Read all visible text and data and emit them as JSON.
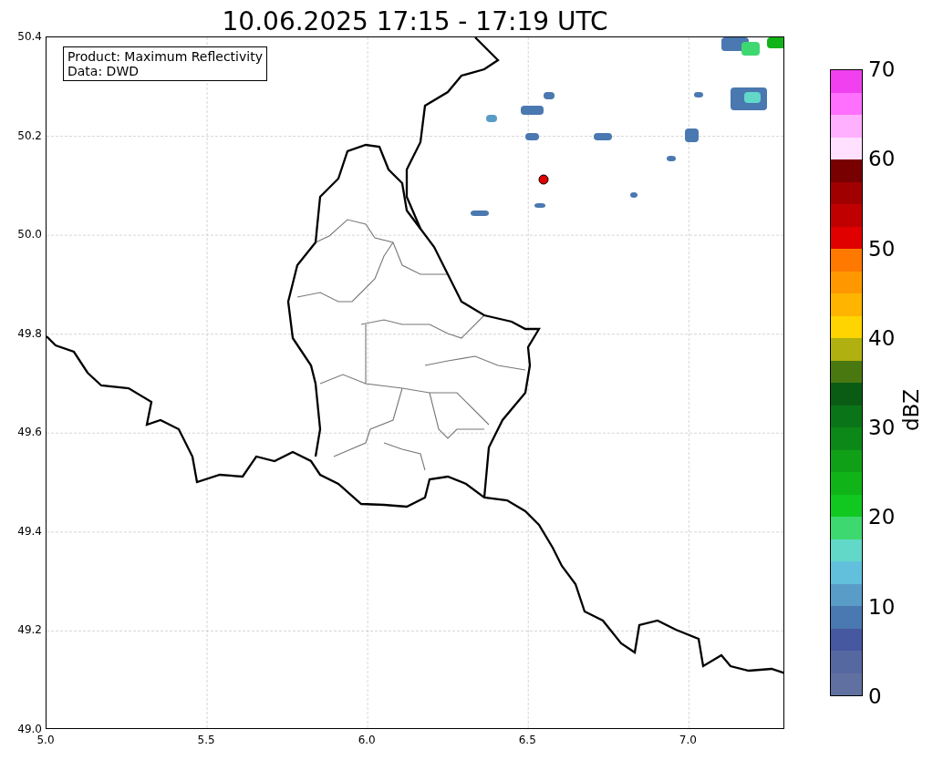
{
  "title": "10.06.2025 17:15 - 17:19 UTC",
  "info_box": {
    "lines": [
      "Product: Maximum Reflectivity",
      "Data: DWD"
    ]
  },
  "x_ticks": [
    "5.0",
    "5.5",
    "6.0",
    "6.5",
    "7.0"
  ],
  "y_ticks": [
    "50.4",
    "50.2",
    "50.0",
    "49.8",
    "49.6",
    "49.4",
    "49.2",
    "49.0"
  ],
  "colorbar": {
    "label": "dBZ",
    "ticks": [
      "70",
      "60",
      "50",
      "40",
      "30",
      "20",
      "10",
      "0"
    ],
    "bands": [
      {
        "color": "#f040f0"
      },
      {
        "color": "#ff70ff"
      },
      {
        "color": "#ffb0ff"
      },
      {
        "color": "#ffe0ff"
      },
      {
        "color": "#780000"
      },
      {
        "color": "#a00000"
      },
      {
        "color": "#c00000"
      },
      {
        "color": "#e00000"
      },
      {
        "color": "#ff7800"
      },
      {
        "color": "#ff9800"
      },
      {
        "color": "#ffb400"
      },
      {
        "color": "#ffd400"
      },
      {
        "color": "#b0b010"
      },
      {
        "color": "#4a7810"
      },
      {
        "color": "#0a5c14"
      },
      {
        "color": "#0a7418"
      },
      {
        "color": "#0c8818"
      },
      {
        "color": "#10a018"
      },
      {
        "color": "#10b418"
      },
      {
        "color": "#10c820"
      },
      {
        "color": "#3ed870"
      },
      {
        "color": "#62d8c8"
      },
      {
        "color": "#62c0dc"
      },
      {
        "color": "#5a9cc8"
      },
      {
        "color": "#4a78b0"
      },
      {
        "color": "#4558a0"
      },
      {
        "color": "#5668a0"
      },
      {
        "color": "#6070a0"
      }
    ]
  }
}
